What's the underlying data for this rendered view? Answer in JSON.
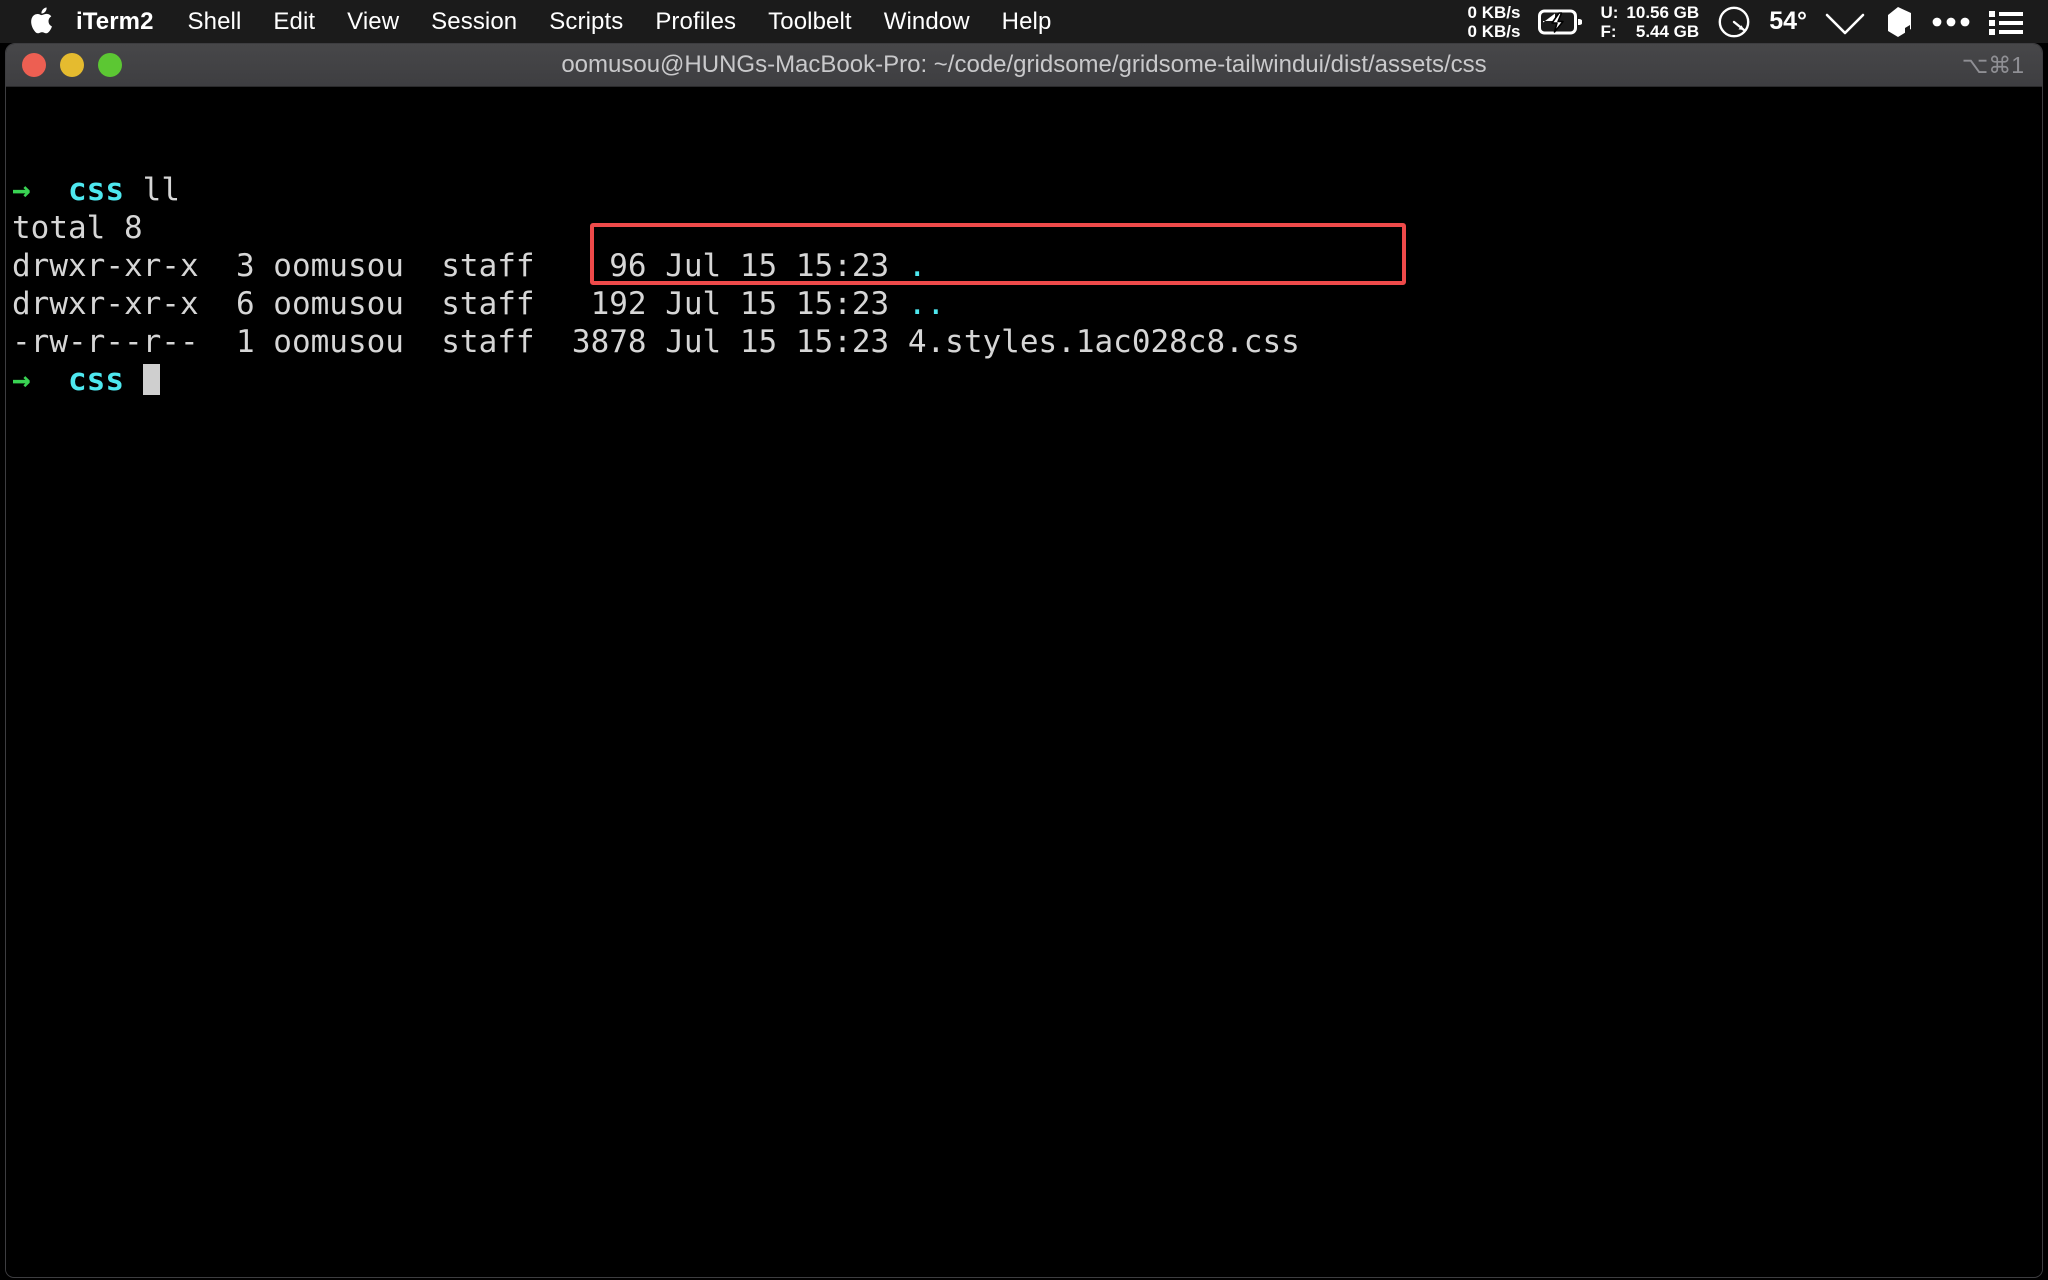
{
  "menubar": {
    "apple_icon": "apple-logo-icon",
    "items": [
      {
        "label": "iTerm2",
        "name": "menu-iterm2",
        "bold": true
      },
      {
        "label": "Shell",
        "name": "menu-shell",
        "bold": false
      },
      {
        "label": "Edit",
        "name": "menu-edit",
        "bold": false
      },
      {
        "label": "View",
        "name": "menu-view",
        "bold": false
      },
      {
        "label": "Session",
        "name": "menu-session",
        "bold": false
      },
      {
        "label": "Scripts",
        "name": "menu-scripts",
        "bold": false
      },
      {
        "label": "Profiles",
        "name": "menu-profiles",
        "bold": false
      },
      {
        "label": "Toolbelt",
        "name": "menu-toolbelt",
        "bold": false
      },
      {
        "label": "Window",
        "name": "menu-window",
        "bold": false
      },
      {
        "label": "Help",
        "name": "menu-help",
        "bold": false
      }
    ],
    "status": {
      "net_up": "0 KB/s",
      "net_down": "0 KB/s",
      "battery_icon": "battery-charging-icon",
      "mem_used_label": "U:",
      "mem_used_value": "10.56 GB",
      "mem_free_label": "F:",
      "mem_free_value": "5.44 GB",
      "clock_icon": "clock-gauge-icon",
      "temperature": "54°",
      "wifi_icon": "wifi-icon",
      "dropbox_icon": "cube-icon",
      "ellipsis_icon": "more-dots-icon",
      "controlcenter_icon": "list-menu-icon"
    }
  },
  "window": {
    "title": "oomusou@HUNGs-MacBook-Pro: ~/code/gridsome/gridsome-tailwindui/dist/assets/css",
    "shortcut": "⌥⌘1",
    "buttons": {
      "close": "close-button",
      "minimize": "minimize-button",
      "zoom": "zoom-button"
    }
  },
  "terminal": {
    "colors": {
      "background": "#000000",
      "foreground": "#d6d6d6",
      "prompt_arrow": "#39d353",
      "prompt_dir": "#4ee8ef",
      "highlight_border": "#ee4a4a"
    },
    "lines": [
      {
        "name": "terminal-line-command",
        "segments": [
          {
            "text": "→  ",
            "class": "c-green"
          },
          {
            "text": "css",
            "class": "c-cyan"
          },
          {
            "text": " ll",
            "class": "c-white"
          }
        ]
      },
      {
        "name": "terminal-line-total",
        "segments": [
          {
            "text": "total 8",
            "class": "c-white"
          }
        ]
      },
      {
        "name": "terminal-line-dir-current",
        "segments": [
          {
            "text": "drwxr-xr-x  3 oomusou  staff    96 Jul 15 15:23 ",
            "class": "c-white"
          },
          {
            "text": ".",
            "class": "c-dir"
          }
        ]
      },
      {
        "name": "terminal-line-dir-parent",
        "segments": [
          {
            "text": "drwxr-xr-x  6 oomusou  staff   192 Jul 15 15:23 ",
            "class": "c-white"
          },
          {
            "text": "..",
            "class": "c-dir"
          }
        ]
      },
      {
        "name": "terminal-line-file-css",
        "segments": [
          {
            "text": "-rw-r--r--  1 oomusou  staff  3878 Jul 15 15:23 4.styles.1ac028c8.css",
            "class": "c-white"
          }
        ]
      },
      {
        "name": "terminal-line-prompt",
        "segments": [
          {
            "text": "→  ",
            "class": "c-green"
          },
          {
            "text": "css",
            "class": "c-cyan"
          },
          {
            "text": " ",
            "class": "c-white"
          }
        ],
        "cursor": true
      }
    ],
    "file_listing": {
      "total": "total 8",
      "rows": [
        {
          "perms": "drwxr-xr-x",
          "links": "3",
          "owner": "oomusou",
          "group": "staff",
          "size": "96",
          "month": "Jul",
          "day": "15",
          "time": "15:23",
          "name": "."
        },
        {
          "perms": "drwxr-xr-x",
          "links": "6",
          "owner": "oomusou",
          "group": "staff",
          "size": "192",
          "month": "Jul",
          "day": "15",
          "time": "15:23",
          "name": ".."
        },
        {
          "perms": "-rw-r--r--",
          "links": "1",
          "owner": "oomusou",
          "group": "staff",
          "size": "3878",
          "month": "Jul",
          "day": "15",
          "time": "15:23",
          "name": "4.styles.1ac028c8.css"
        }
      ]
    },
    "annotation": {
      "name": "highlight-rectangle",
      "highlighted_text": "3878 Jul 15 15:23 4.styles.1ac028c8.css"
    }
  }
}
